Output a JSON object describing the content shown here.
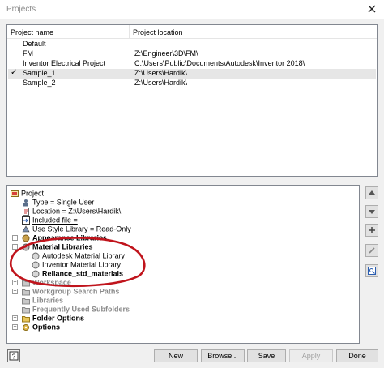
{
  "window": {
    "title": "Projects"
  },
  "project_list": {
    "columns": [
      "Project name",
      "Project location"
    ],
    "rows": [
      {
        "name": "Default",
        "location": "",
        "active": false
      },
      {
        "name": "FM",
        "location": "Z:\\Engineer\\3D\\FM\\",
        "active": false
      },
      {
        "name": "Inventor Electrical Project",
        "location": "C:\\Users\\Public\\Documents\\Autodesk\\Inventor 2018\\",
        "active": false
      },
      {
        "name": "Sample_1",
        "location": "Z:\\Users\\Hardik\\",
        "active": true
      },
      {
        "name": "Sample_2",
        "location": "Z:\\Users\\Hardik\\",
        "active": false
      }
    ],
    "checkmark": "✓"
  },
  "tree": {
    "root": "Project",
    "type": "Type = Single User",
    "location": "Location = Z:\\Users\\Hardik\\",
    "included_file": "Included file =",
    "use_style_library": "Use Style Library = Read-Only",
    "appearance_libraries": "Appearance Libraries",
    "material_libraries": "Material Libraries",
    "material_items": [
      "Autodesk Material Library",
      "Inventor Material Library",
      "Reliance_std_materials"
    ],
    "workspace": "Workspace",
    "workgroup_search_paths": "Workgroup Search Paths",
    "libraries": "Libraries",
    "frequently_used_subfolders": "Frequently Used Subfolders",
    "folder_options": "Folder Options",
    "options": "Options"
  },
  "buttons": {
    "new": "New",
    "browse": "Browse...",
    "save": "Save",
    "apply": "Apply",
    "done": "Done"
  },
  "colors": {
    "annotation": "#c0141c",
    "tree_border": "#828790"
  },
  "icons": {
    "side": [
      "scroll-up-icon",
      "scroll-down-icon",
      "add-icon",
      "edit-icon",
      "find-icon"
    ],
    "help": "help-icon"
  }
}
